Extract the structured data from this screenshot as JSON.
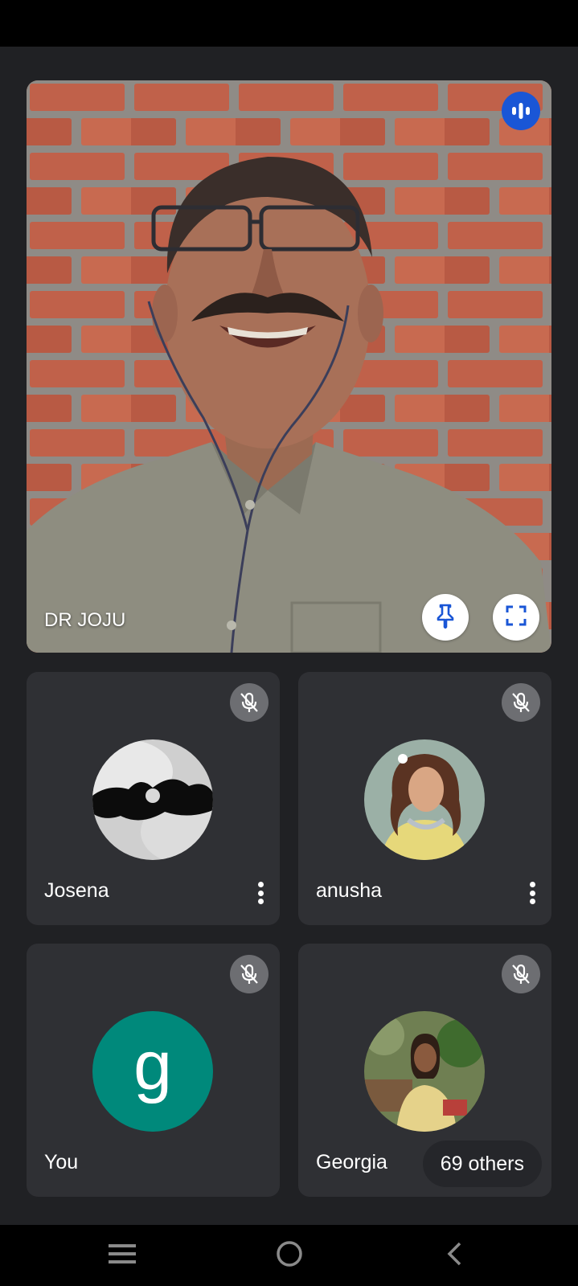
{
  "main_speaker": {
    "name": "DR JOJU"
  },
  "participants": [
    {
      "name": "Josena",
      "avatar": "photo"
    },
    {
      "name": "anusha",
      "avatar": "photo"
    },
    {
      "name": "You",
      "avatar_letter": "g"
    },
    {
      "name": "Georgia",
      "avatar": "photo"
    }
  ],
  "others_label": "69 others",
  "colors": {
    "background": "#202124",
    "tile": "#2f3034",
    "speaking_badge": "#1a56d6",
    "letter_avatar": "#00897b"
  },
  "icons": {
    "speaking": "audio-level-icon",
    "pin": "pin-icon",
    "fullscreen": "fullscreen-icon",
    "mic_off": "mic-off-icon",
    "more": "more-vert-icon",
    "nav_recent": "recent-apps-icon",
    "nav_home": "home-icon",
    "nav_back": "back-icon"
  }
}
